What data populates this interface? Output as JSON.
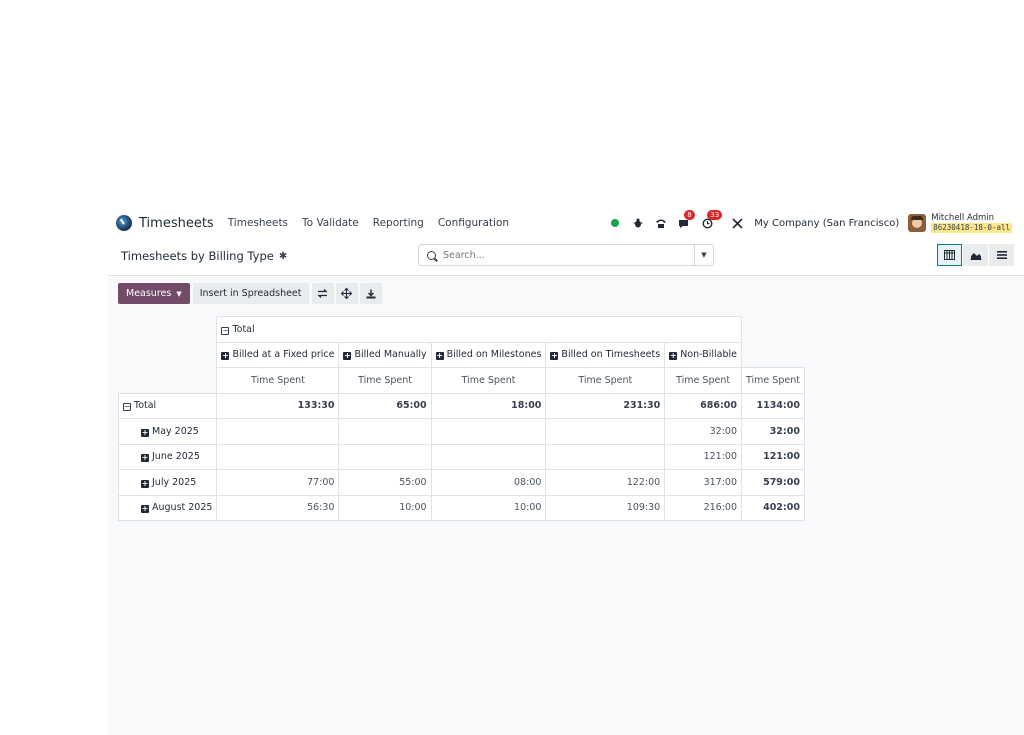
{
  "navbar": {
    "app_name": "Timesheets",
    "menu": [
      "Timesheets",
      "To Validate",
      "Reporting",
      "Configuration"
    ],
    "systray": {
      "messages_count": "8",
      "activities_count": "33",
      "company": "My Company (San Francisco)",
      "user_name": "Mitchell Admin",
      "database": "86230418-18-0-all"
    }
  },
  "control": {
    "title": "Timesheets by Billing Type",
    "search_placeholder": "Search..."
  },
  "toolbar": {
    "measures_label": "Measures",
    "insert_label": "Insert in Spreadsheet"
  },
  "pivot": {
    "column_group": "Total",
    "columns": [
      "Billed at a Fixed price",
      "Billed Manually",
      "Billed on Milestones",
      "Billed on Timesheets",
      "Non-Billable"
    ],
    "measure": "Time Spent",
    "rows": [
      {
        "label": "Total",
        "values": [
          "133:30",
          "65:00",
          "18:00",
          "231:30",
          "686:00"
        ],
        "total": "1134:00"
      },
      {
        "label": "May 2025",
        "values": [
          "",
          "",
          "",
          "",
          "32:00"
        ],
        "total": "32:00"
      },
      {
        "label": "June 2025",
        "values": [
          "",
          "",
          "",
          "",
          "121:00"
        ],
        "total": "121:00"
      },
      {
        "label": "July 2025",
        "values": [
          "77:00",
          "55:00",
          "08:00",
          "122:00",
          "317:00"
        ],
        "total": "579:00"
      },
      {
        "label": "August 2025",
        "values": [
          "56:30",
          "10:00",
          "10:00",
          "109:30",
          "216:00"
        ],
        "total": "402:00"
      }
    ]
  }
}
